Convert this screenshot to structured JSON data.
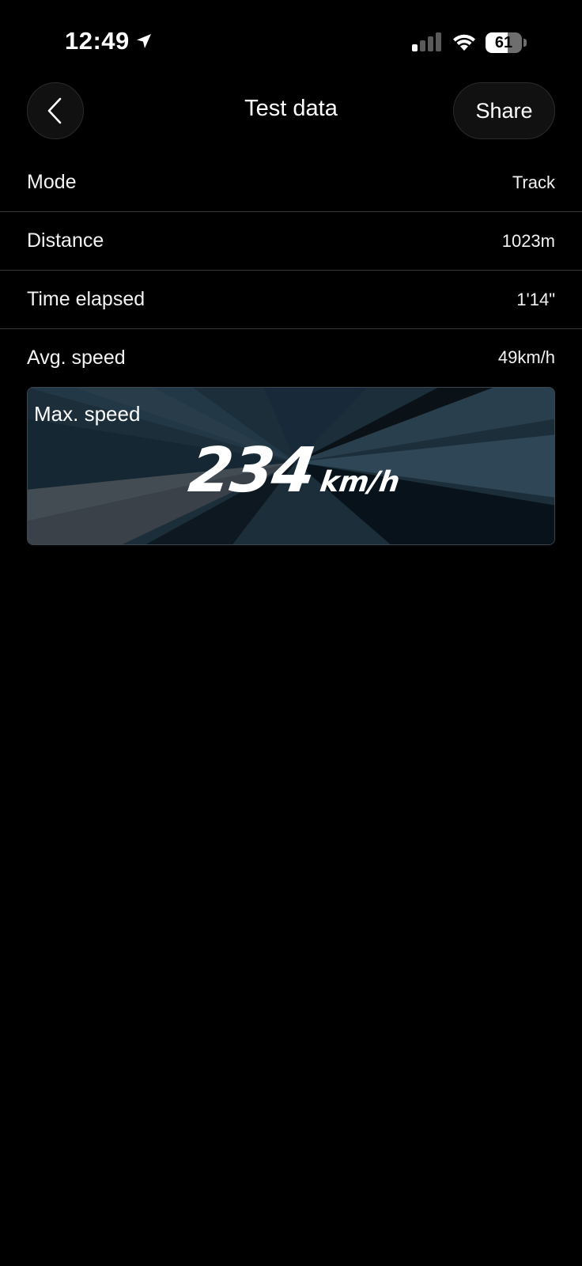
{
  "status_bar": {
    "time": "12:49",
    "battery_level": "61",
    "battery_fraction": 0.61,
    "icons": [
      "location-arrow-icon",
      "cellular-signal-icon",
      "wifi-icon",
      "battery-icon"
    ]
  },
  "header": {
    "back_icon": "chevron-left-icon",
    "title": "Test data",
    "share_label": "Share"
  },
  "stats": [
    {
      "label": "Mode",
      "value": "Track"
    },
    {
      "label": "Distance",
      "value": "1023m"
    },
    {
      "label": "Time elapsed",
      "value": "1'14\""
    },
    {
      "label": "Avg. speed",
      "value": "49km/h"
    }
  ],
  "max_speed": {
    "label": "Max. speed",
    "value": "234",
    "unit": "km/h"
  },
  "colors": {
    "background": "#000000",
    "card_base": "#1c2f3b",
    "divider": "#3a3a3a"
  }
}
